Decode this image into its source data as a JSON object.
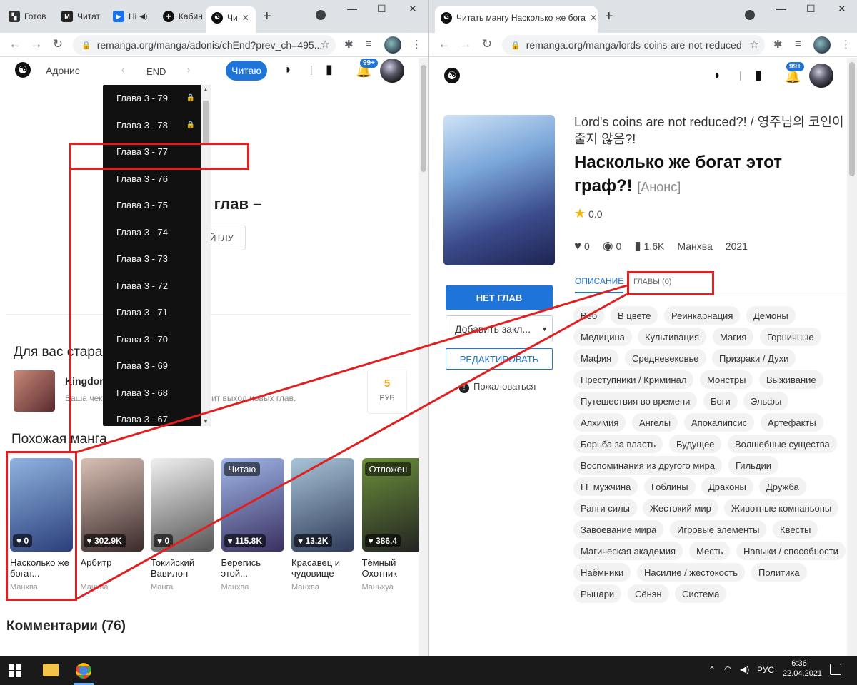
{
  "left": {
    "tabs": [
      {
        "label": "Готов",
        "color": "#333"
      },
      {
        "label": "Читат",
        "color": "#222"
      },
      {
        "label": "Ні",
        "color": "#1a73e8"
      },
      {
        "label": "Кабин",
        "color": "#111"
      },
      {
        "label": "Чи",
        "color": "#111"
      }
    ],
    "url": "remanga.org/manga/adonis/chEnd?prev_ch=495...",
    "header": {
      "title": "Адонис",
      "chapter": "END",
      "read_button": "Читаю",
      "notif_count": "99+"
    },
    "dropdown_items": [
      {
        "label": "Глава 3 - 79",
        "locked": true
      },
      {
        "label": "Глава 3 - 78",
        "locked": true
      },
      {
        "label": "Глава 3 - 77",
        "locked": false
      },
      {
        "label": "Глава 3 - 76",
        "locked": false
      },
      {
        "label": "Глава 3 - 75",
        "locked": false
      },
      {
        "label": "Глава 3 - 74",
        "locked": false
      },
      {
        "label": "Глава 3 - 73",
        "locked": false
      },
      {
        "label": "Глава 3 - 72",
        "locked": false
      },
      {
        "label": "Глава 3 - 71",
        "locked": false
      },
      {
        "label": "Глава 3 - 70",
        "locked": false
      },
      {
        "label": "Глава 3 - 69",
        "locked": false
      },
      {
        "label": "Глава 3 - 68",
        "locked": false
      },
      {
        "label": "Глава 3 - 67",
        "locked": false
      }
    ],
    "end_text": "ц глав –",
    "end_button": "ЙТЛУ",
    "for_you": "Для вас стара",
    "promo": {
      "title": "Kingdom",
      "desc": "Ваша чек",
      "desc2": "ит выход новых глав.",
      "price": "5",
      "currency": "РУБ"
    },
    "similar_title": "Похожая манга",
    "cards": [
      {
        "title": "Насколько же богат...",
        "type": "Манхва",
        "likes": "0",
        "status": "",
        "c1": "#8fb3e0",
        "c2": "#2b3f7a"
      },
      {
        "title": "Арбитр",
        "type": "Манхва",
        "likes": "302.9K",
        "status": "",
        "c1": "#d9c0b5",
        "c2": "#3a2a2a"
      },
      {
        "title": "Токийский Вавилон",
        "type": "Манга",
        "likes": "0",
        "status": "",
        "c1": "#f0f0f0",
        "c2": "#555"
      },
      {
        "title": "Берегись этой...",
        "type": "Манхва",
        "likes": "115.8K",
        "status": "Читаю",
        "c1": "#9fb7e8",
        "c2": "#3a3060"
      },
      {
        "title": "Красавец и чудовище",
        "type": "Манхва",
        "likes": "13.2K",
        "status": "",
        "c1": "#a8c4d8",
        "c2": "#2e3a58"
      },
      {
        "title": "Тёмный Охотник",
        "type": "Маньхуа",
        "likes": "386.4",
        "status": "Отложен",
        "c1": "#6b8f3a",
        "c2": "#222"
      }
    ],
    "comments_title": "Комментарии (76)"
  },
  "right": {
    "tab_label": "Читать мангу Насколько же бога",
    "url": "remanga.org/manga/lords-coins-are-not-reduced",
    "notif_count": "99+",
    "orig_title": "Lord's coins are not reduced?! / 영주님의 코인이 줄지 않음?!",
    "title": "Насколько же богат этот граф?!",
    "announce": "[Анонс]",
    "rating": "0.0",
    "stats": {
      "likes": "0",
      "views": "0",
      "bookmarks": "1.6K",
      "type": "Манхва",
      "year": "2021"
    },
    "tab_desc": "ОПИСАНИЕ",
    "tab_chapters": "ГЛАВЫ (0)",
    "btn_no_chapters": "НЕТ ГЛАВ",
    "select_bookmark": "Добавить закл...",
    "btn_edit": "РЕДАКТИРОВАТЬ",
    "complain": "Пожаловаться",
    "tags": [
      "Веб",
      "В цвете",
      "Реинкарнация",
      "Демоны",
      "Медицина",
      "Культивация",
      "Магия",
      "Горничные",
      "Мафия",
      "Средневековье",
      "Призраки / Духи",
      "Преступники / Криминал",
      "Монстры",
      "Выживание",
      "Путешествия во времени",
      "Боги",
      "Эльфы",
      "Алхимия",
      "Ангелы",
      "Апокалипсис",
      "Артефакты",
      "Борьба за власть",
      "Будущее",
      "Волшебные существа",
      "Воспоминания из другого мира",
      "Гильдии",
      "ГГ мужчина",
      "Гоблины",
      "Драконы",
      "Дружба",
      "Ранги силы",
      "Жестокий мир",
      "Животные компаньоны",
      "Завоевание мира",
      "Игровые элементы",
      "Квесты",
      "Магическая академия",
      "Месть",
      "Навыки / способности",
      "Наёмники",
      "Насилие / жестокость",
      "Политика",
      "Рыцари",
      "Сёнэн",
      "Система"
    ]
  },
  "taskbar": {
    "lang": "РУС",
    "time": "6:36",
    "date": "22.04.2021"
  },
  "colors": {
    "accent": "#1e74d8",
    "highlight": "#e02020"
  }
}
